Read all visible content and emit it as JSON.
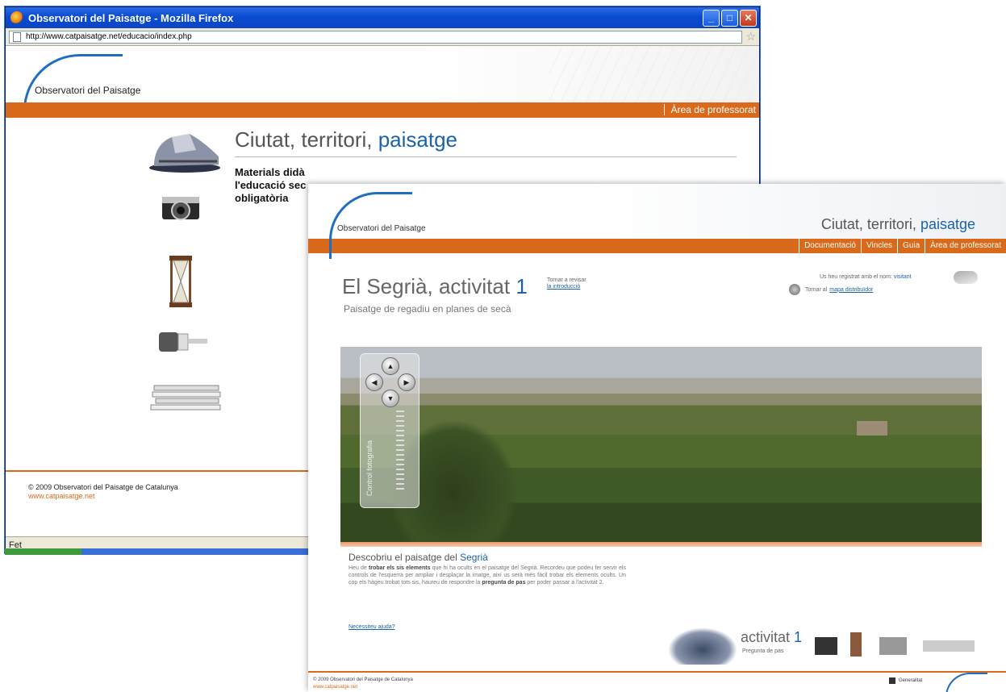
{
  "back_window": {
    "title": "Observatori del Paisatge - Mozilla Firefox",
    "url": "http://www.catpaisatge.net/educacio/index.php",
    "logo_text": "Observatori del Paisatge",
    "nav_link": "Àrea de professorat",
    "heading_part1": "Ciutat, territori, ",
    "heading_part2": "paisatge",
    "desc_line1": "Materials didà",
    "desc_line2": "l'educació sec",
    "desc_line3": "obligatòria",
    "footer_copy": "© 2009 Observatori del Paisatge de Catalunya",
    "footer_url": "www.catpaisatge.net",
    "status": "Fet"
  },
  "front_page": {
    "logo_text": "Observatori del Paisatge",
    "tagline_part1": "Ciutat, territori, ",
    "tagline_part2": "paisatge",
    "nav": [
      "Documentació",
      "Vincles",
      "Guia",
      "Àrea de professorat"
    ],
    "title": "El Segrià, activitat ",
    "title_num": "1",
    "intro_line1": "Tornar a revisar",
    "intro_link": "la introducció",
    "subtitle": "Paisatge de regadiu en planes de secà",
    "user_text": "Us heu registrat amb el nom: ",
    "user_name": "visitant",
    "back_text": "Tornar al ",
    "back_link": "mapa distribuïdor",
    "controls_label": "Control fotografia",
    "desc_title_part1": "Descobriu el paisatge del ",
    "desc_title_part2": "Segrià",
    "desc_p1": "Heu de ",
    "desc_b1": "trobar els sis elements",
    "desc_p2": " que hi ha ocults en el paisatge del Segrià. Recordeu que podeu fer servir els controls de l'esquerra per ampliar i desplaçar la imatge, així us serà més fàcil trobar els elements ocults. Un cop els hàgeu trobat tots sis, haureu de respondre la ",
    "desc_b2": "pregunta de pas",
    "desc_p3": " per poder passar a l'activitat 2.",
    "help_link": "Necessiteu ajuda?",
    "act_title": "activitat ",
    "act_num": "1",
    "act_sub": "Pregunta de pas",
    "footer_copy": "© 2009 Observatori del Paisatge de Catalunya",
    "footer_url": "www.catpaisatge.net",
    "gen_text": "Generalitat"
  }
}
